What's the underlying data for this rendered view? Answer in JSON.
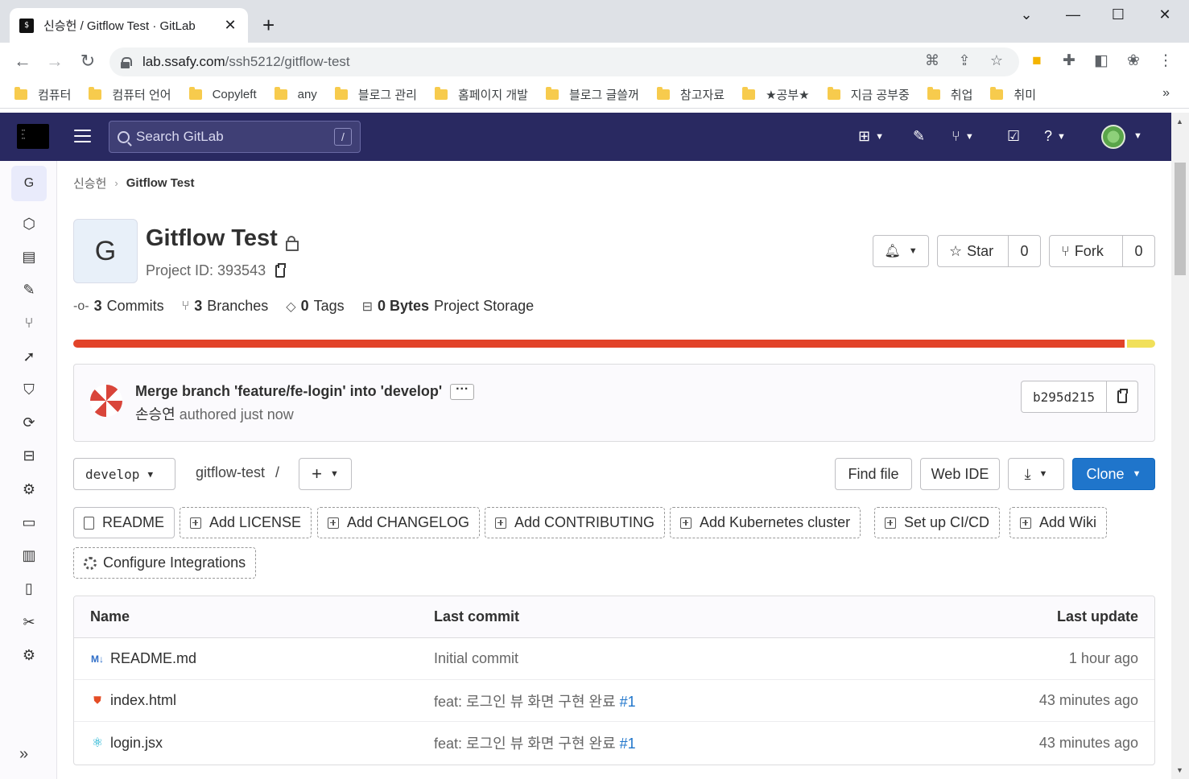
{
  "browser": {
    "tab_title": "신승헌 / Gitflow Test · GitLab",
    "url_host": "lab.ssafy.com",
    "url_path": "/ssh5212/gitflow-test",
    "bookmarks": [
      "컴퓨터",
      "컴퓨터 언어",
      "Copyleft",
      "any",
      "블로그 관리",
      "홈페이지 개발",
      "블로그 글쓸꺼",
      "참고자료",
      "★공부★",
      "지금 공부중",
      "취업",
      "취미"
    ]
  },
  "header": {
    "search_placeholder": "Search GitLab",
    "search_shortcut": "/"
  },
  "sidebar": {
    "project_letter": "G"
  },
  "breadcrumb": {
    "namespace": "신승헌",
    "project": "Gitflow Test"
  },
  "project": {
    "avatar_letter": "G",
    "name": "Gitflow Test",
    "id_label": "Project ID: 393543",
    "star_label": "Star",
    "star_count": "0",
    "fork_label": "Fork",
    "fork_count": "0"
  },
  "stats": {
    "commits_count": "3",
    "commits_label": "Commits",
    "branches_count": "3",
    "branches_label": "Branches",
    "tags_count": "0",
    "tags_label": "Tags",
    "storage_value": "0 Bytes",
    "storage_label": "Project Storage"
  },
  "languages": [
    {
      "color": "#e24329",
      "fraction": 0.974
    },
    {
      "color": "#f1e05a",
      "fraction": 0.026
    }
  ],
  "last_commit": {
    "title": "Merge branch 'feature/fe-login' into 'develop'",
    "author": "손승연",
    "meta": "authored just now",
    "sha": "b295d215"
  },
  "repo_nav": {
    "branch": "develop",
    "path": "gitflow-test",
    "path_sep": "/",
    "find_file": "Find file",
    "web_ide": "Web IDE",
    "clone": "Clone"
  },
  "quick_actions": {
    "readme": "README",
    "license": "Add LICENSE",
    "changelog": "Add CHANGELOG",
    "contributing": "Add CONTRIBUTING",
    "kubernetes": "Add Kubernetes cluster",
    "cicd": "Set up CI/CD",
    "wiki": "Add Wiki",
    "integrations": "Configure Integrations"
  },
  "file_table": {
    "headers": {
      "name": "Name",
      "commit": "Last commit",
      "update": "Last update"
    },
    "rows": [
      {
        "name": "README.md",
        "icon": "markdown-icon",
        "commit": "Initial commit",
        "ref": "",
        "update": "1 hour ago"
      },
      {
        "name": "index.html",
        "icon": "html5-icon",
        "commit": "feat: 로그인 뷰 화면 구현 완료 ",
        "ref": "#1",
        "update": "43 minutes ago"
      },
      {
        "name": "login.jsx",
        "icon": "react-icon",
        "commit": "feat: 로그인 뷰 화면 구현 완료 ",
        "ref": "#1",
        "update": "43 minutes ago"
      }
    ]
  }
}
